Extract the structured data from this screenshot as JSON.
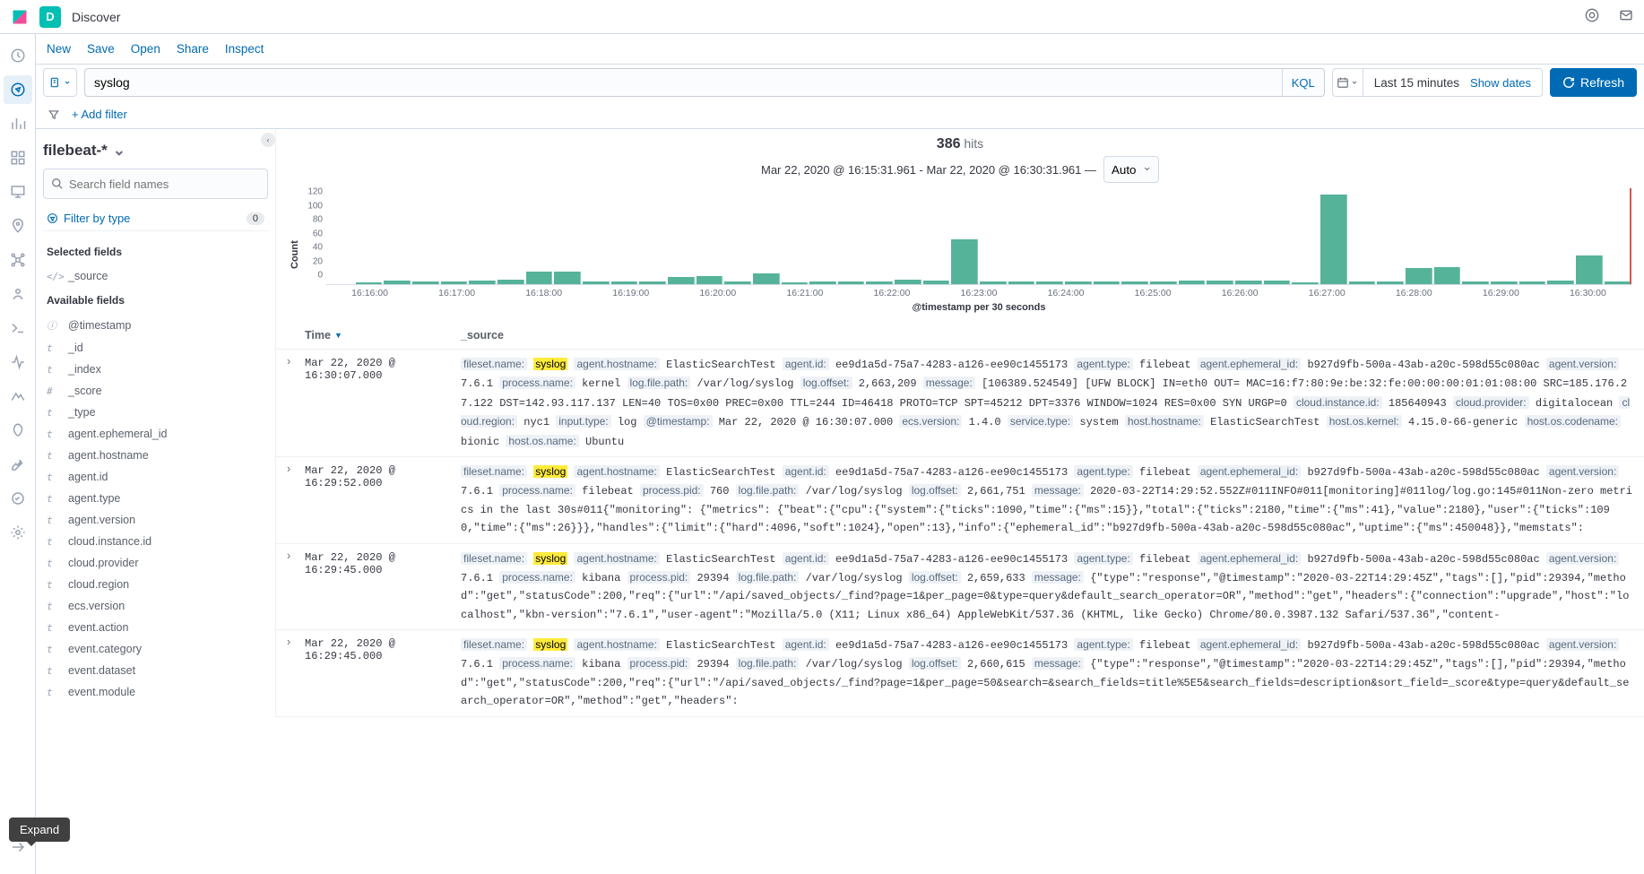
{
  "header": {
    "space_letter": "D",
    "app_title": "Discover"
  },
  "subnav": {
    "new": "New",
    "save": "Save",
    "open": "Open",
    "share": "Share",
    "inspect": "Inspect"
  },
  "querybar": {
    "query_value": "syslog",
    "kql_label": "KQL",
    "time_text": "Last 15 minutes",
    "show_dates": "Show dates",
    "refresh": "Refresh"
  },
  "filterbar": {
    "add_filter": "+ Add filter"
  },
  "sidebar": {
    "index_pattern": "filebeat-*",
    "search_placeholder": "Search field names",
    "filter_by_type": "Filter by type",
    "filter_type_count": "0",
    "selected_label": "Selected fields",
    "available_label": "Available fields",
    "selected_fields": [
      {
        "type": "</>",
        "name": "_source"
      }
    ],
    "available_fields": [
      {
        "type": "ⓘ",
        "name": "@timestamp"
      },
      {
        "type": "t",
        "name": "_id"
      },
      {
        "type": "t",
        "name": "_index"
      },
      {
        "type": "#",
        "name": "_score"
      },
      {
        "type": "t",
        "name": "_type"
      },
      {
        "type": "t",
        "name": "agent.ephemeral_id"
      },
      {
        "type": "t",
        "name": "agent.hostname"
      },
      {
        "type": "t",
        "name": "agent.id"
      },
      {
        "type": "t",
        "name": "agent.type"
      },
      {
        "type": "t",
        "name": "agent.version"
      },
      {
        "type": "t",
        "name": "cloud.instance.id"
      },
      {
        "type": "t",
        "name": "cloud.provider"
      },
      {
        "type": "t",
        "name": "cloud.region"
      },
      {
        "type": "t",
        "name": "ecs.version"
      },
      {
        "type": "t",
        "name": "event.action"
      },
      {
        "type": "t",
        "name": "event.category"
      },
      {
        "type": "t",
        "name": "event.dataset"
      },
      {
        "type": "t",
        "name": "event.module"
      }
    ]
  },
  "hits": {
    "count": "386",
    "label": "hits"
  },
  "range": {
    "text": "Mar 22, 2020 @ 16:15:31.961 - Mar 22, 2020 @ 16:30:31.961 —",
    "interval": "Auto"
  },
  "chart_data": {
    "type": "bar",
    "ylabel": "Count",
    "xlabel": "@timestamp per 30 seconds",
    "ylim": [
      0,
      140
    ],
    "y_ticks": [
      0,
      20,
      40,
      60,
      80,
      100,
      120
    ],
    "x_ticks": [
      "16:16:00",
      "16:17:00",
      "16:18:00",
      "16:19:00",
      "16:20:00",
      "16:21:00",
      "16:22:00",
      "16:23:00",
      "16:24:00",
      "16:25:00",
      "16:26:00",
      "16:27:00",
      "16:28:00",
      "16:29:00",
      "16:30:00"
    ],
    "values": [
      0,
      2,
      5,
      4,
      4,
      5,
      6,
      18,
      18,
      4,
      4,
      4,
      10,
      12,
      4,
      16,
      3,
      4,
      4,
      4,
      6,
      5,
      66,
      4,
      4,
      4,
      4,
      4,
      4,
      4,
      5,
      5,
      5,
      5,
      3,
      131,
      4,
      4,
      23,
      25,
      4,
      4,
      4,
      5,
      42,
      4
    ]
  },
  "table": {
    "col_time": "Time",
    "col_source": "_source",
    "rows": [
      {
        "time": "Mar 22, 2020 @ 16:30:07.000",
        "source": [
          {
            "k": "fileset.name:",
            "v": "syslog",
            "hl": true
          },
          {
            "k": "agent.hostname:",
            "v": "ElasticSearchTest"
          },
          {
            "k": "agent.id:",
            "v": "ee9d1a5d-75a7-4283-a126-ee90c1455173"
          },
          {
            "k": "agent.type:",
            "v": "filebeat"
          },
          {
            "k": "agent.ephemeral_id:",
            "v": "b927d9fb-500a-43ab-a20c-598d55c080ac"
          },
          {
            "k": "agent.version:",
            "v": "7.6.1"
          },
          {
            "k": "process.name:",
            "v": "kernel"
          },
          {
            "k": "log.file.path:",
            "v": "/var/log/syslog"
          },
          {
            "k": "log.offset:",
            "v": "2,663,209"
          },
          {
            "k": "message:",
            "v": "[106389.524549] [UFW BLOCK] IN=eth0 OUT= MAC=16:f7:80:9e:be:32:fe:00:00:00:01:01:08:00 SRC=185.176.27.122 DST=142.93.117.137 LEN=40 TOS=0x00 PREC=0x00 TTL=244 ID=46418 PROTO=TCP SPT=45212 DPT=3376 WINDOW=1024 RES=0x00 SYN URGP=0"
          },
          {
            "k": "cloud.instance.id:",
            "v": "185640943"
          },
          {
            "k": "cloud.provider:",
            "v": "digitalocean"
          },
          {
            "k": "cloud.region:",
            "v": "nyc1"
          },
          {
            "k": "input.type:",
            "v": "log"
          },
          {
            "k": "@timestamp:",
            "v": "Mar 22, 2020 @ 16:30:07.000"
          },
          {
            "k": "ecs.version:",
            "v": "1.4.0"
          },
          {
            "k": "service.type:",
            "v": "system"
          },
          {
            "k": "host.hostname:",
            "v": "ElasticSearchTest"
          },
          {
            "k": "host.os.kernel:",
            "v": "4.15.0-66-generic"
          },
          {
            "k": "host.os.codename:",
            "v": "bionic"
          },
          {
            "k": "host.os.name:",
            "v": "Ubuntu"
          }
        ]
      },
      {
        "time": "Mar 22, 2020 @ 16:29:52.000",
        "source": [
          {
            "k": "fileset.name:",
            "v": "syslog",
            "hl": true
          },
          {
            "k": "agent.hostname:",
            "v": "ElasticSearchTest"
          },
          {
            "k": "agent.id:",
            "v": "ee9d1a5d-75a7-4283-a126-ee90c1455173"
          },
          {
            "k": "agent.type:",
            "v": "filebeat"
          },
          {
            "k": "agent.ephemeral_id:",
            "v": "b927d9fb-500a-43ab-a20c-598d55c080ac"
          },
          {
            "k": "agent.version:",
            "v": "7.6.1"
          },
          {
            "k": "process.name:",
            "v": "filebeat"
          },
          {
            "k": "process.pid:",
            "v": "760"
          },
          {
            "k": "log.file.path:",
            "v": "/var/log/syslog"
          },
          {
            "k": "log.offset:",
            "v": "2,661,751"
          },
          {
            "k": "message:",
            "v": "2020-03-22T14:29:52.552Z#011INFO#011[monitoring]#011log/log.go:145#011Non-zero metrics in the last 30s#011{\"monitoring\": {\"metrics\": {\"beat\":{\"cpu\":{\"system\":{\"ticks\":1090,\"time\":{\"ms\":15}},\"total\":{\"ticks\":2180,\"time\":{\"ms\":41},\"value\":2180},\"user\":{\"ticks\":1090,\"time\":{\"ms\":26}}},\"handles\":{\"limit\":{\"hard\":4096,\"soft\":1024},\"open\":13},\"info\":{\"ephemeral_id\":\"b927d9fb-500a-43ab-a20c-598d55c080ac\",\"uptime\":{\"ms\":450048}},\"memstats\":"
          }
        ]
      },
      {
        "time": "Mar 22, 2020 @ 16:29:45.000",
        "source": [
          {
            "k": "fileset.name:",
            "v": "syslog",
            "hl": true
          },
          {
            "k": "agent.hostname:",
            "v": "ElasticSearchTest"
          },
          {
            "k": "agent.id:",
            "v": "ee9d1a5d-75a7-4283-a126-ee90c1455173"
          },
          {
            "k": "agent.type:",
            "v": "filebeat"
          },
          {
            "k": "agent.ephemeral_id:",
            "v": "b927d9fb-500a-43ab-a20c-598d55c080ac"
          },
          {
            "k": "agent.version:",
            "v": "7.6.1"
          },
          {
            "k": "process.name:",
            "v": "kibana"
          },
          {
            "k": "process.pid:",
            "v": "29394"
          },
          {
            "k": "log.file.path:",
            "v": "/var/log/syslog"
          },
          {
            "k": "log.offset:",
            "v": "2,659,633"
          },
          {
            "k": "message:",
            "v": "{\"type\":\"response\",\"@timestamp\":\"2020-03-22T14:29:45Z\",\"tags\":[],\"pid\":29394,\"method\":\"get\",\"statusCode\":200,\"req\":{\"url\":\"/api/saved_objects/_find?page=1&per_page=0&type=query&default_search_operator=OR\",\"method\":\"get\",\"headers\":{\"connection\":\"upgrade\",\"host\":\"localhost\",\"kbn-version\":\"7.6.1\",\"user-agent\":\"Mozilla/5.0 (X11; Linux x86_64) AppleWebKit/537.36 (KHTML, like Gecko) Chrome/80.0.3987.132 Safari/537.36\",\"content-"
          }
        ]
      },
      {
        "time": "Mar 22, 2020 @ 16:29:45.000",
        "source": [
          {
            "k": "fileset.name:",
            "v": "syslog",
            "hl": true
          },
          {
            "k": "agent.hostname:",
            "v": "ElasticSearchTest"
          },
          {
            "k": "agent.id:",
            "v": "ee9d1a5d-75a7-4283-a126-ee90c1455173"
          },
          {
            "k": "agent.type:",
            "v": "filebeat"
          },
          {
            "k": "agent.ephemeral_id:",
            "v": "b927d9fb-500a-43ab-a20c-598d55c080ac"
          },
          {
            "k": "agent.version:",
            "v": "7.6.1"
          },
          {
            "k": "process.name:",
            "v": "kibana"
          },
          {
            "k": "process.pid:",
            "v": "29394"
          },
          {
            "k": "log.file.path:",
            "v": "/var/log/syslog"
          },
          {
            "k": "log.offset:",
            "v": "2,660,615"
          },
          {
            "k": "message:",
            "v": "{\"type\":\"response\",\"@timestamp\":\"2020-03-22T14:29:45Z\",\"tags\":[],\"pid\":29394,\"method\":\"get\",\"statusCode\":200,\"req\":{\"url\":\"/api/saved_objects/_find?page=1&per_page=50&search=&search_fields=title%5E5&search_fields=description&sort_field=_score&type=query&default_search_operator=OR\",\"method\":\"get\",\"headers\":"
          }
        ]
      }
    ]
  },
  "tooltip": {
    "text": "Expand"
  }
}
